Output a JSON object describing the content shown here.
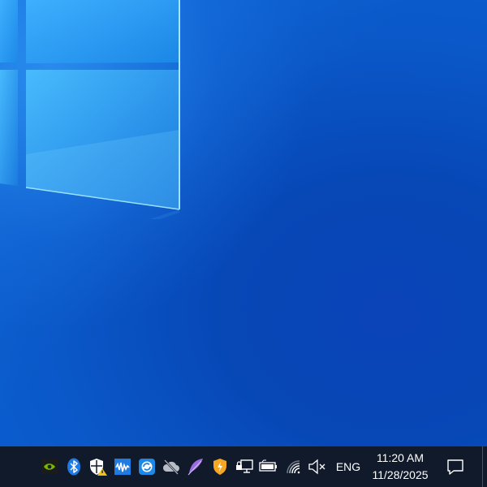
{
  "desktop": {
    "wallpaper": "windows-10-hero",
    "accent": "#0a57c8"
  },
  "taskbar": {
    "background": "#101a2a",
    "tray_icons": [
      {
        "name": "nvidia-icon"
      },
      {
        "name": "bluetooth-icon"
      },
      {
        "name": "security-warning-icon"
      },
      {
        "name": "audio-app-icon"
      },
      {
        "name": "sync-icon"
      },
      {
        "name": "cloud-offline-icon"
      },
      {
        "name": "feather-icon"
      },
      {
        "name": "shield-icon"
      },
      {
        "name": "network-lock-icon"
      },
      {
        "name": "battery-icon"
      },
      {
        "name": "wifi-icon"
      },
      {
        "name": "volume-muted-icon"
      }
    ],
    "language": "ENG",
    "time": "11:20 AM",
    "date": "11/28/2025"
  }
}
